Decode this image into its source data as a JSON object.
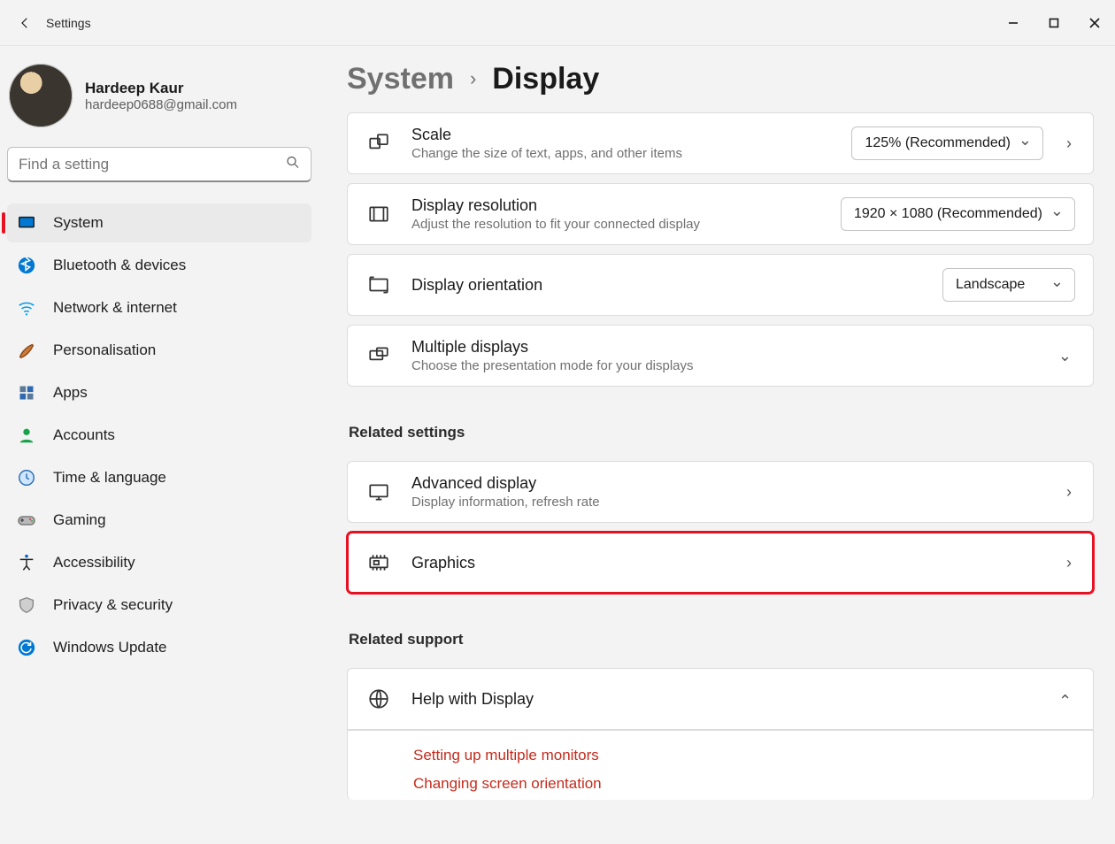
{
  "app_title": "Settings",
  "profile": {
    "name": "Hardeep Kaur",
    "email": "hardeep0688@gmail.com"
  },
  "search": {
    "placeholder": "Find a setting"
  },
  "sidebar": {
    "items": [
      {
        "label": "System",
        "icon": "system",
        "selected": true
      },
      {
        "label": "Bluetooth & devices",
        "icon": "bluetooth",
        "selected": false
      },
      {
        "label": "Network & internet",
        "icon": "wifi",
        "selected": false
      },
      {
        "label": "Personalisation",
        "icon": "brush",
        "selected": false
      },
      {
        "label": "Apps",
        "icon": "apps",
        "selected": false
      },
      {
        "label": "Accounts",
        "icon": "person",
        "selected": false
      },
      {
        "label": "Time & language",
        "icon": "clock",
        "selected": false
      },
      {
        "label": "Gaming",
        "icon": "gamepad",
        "selected": false
      },
      {
        "label": "Accessibility",
        "icon": "accessibility",
        "selected": false
      },
      {
        "label": "Privacy & security",
        "icon": "shield",
        "selected": false
      },
      {
        "label": "Windows Update",
        "icon": "update",
        "selected": false
      }
    ]
  },
  "breadcrumb": {
    "parent": "System",
    "current": "Display"
  },
  "main": {
    "scale": {
      "title": "Scale",
      "subtitle": "Change the size of text, apps, and other items",
      "value": "125% (Recommended)"
    },
    "resolution": {
      "title": "Display resolution",
      "subtitle": "Adjust the resolution to fit your connected display",
      "value": "1920 × 1080 (Recommended)"
    },
    "orientation": {
      "title": "Display orientation",
      "value": "Landscape"
    },
    "multiple_displays": {
      "title": "Multiple displays",
      "subtitle": "Choose the presentation mode for your displays"
    },
    "related_settings_header": "Related settings",
    "advanced_display": {
      "title": "Advanced display",
      "subtitle": "Display information, refresh rate"
    },
    "graphics": {
      "title": "Graphics"
    },
    "related_support_header": "Related support",
    "help": {
      "title": "Help with Display",
      "links": [
        "Setting up multiple monitors",
        "Changing screen orientation"
      ]
    }
  }
}
